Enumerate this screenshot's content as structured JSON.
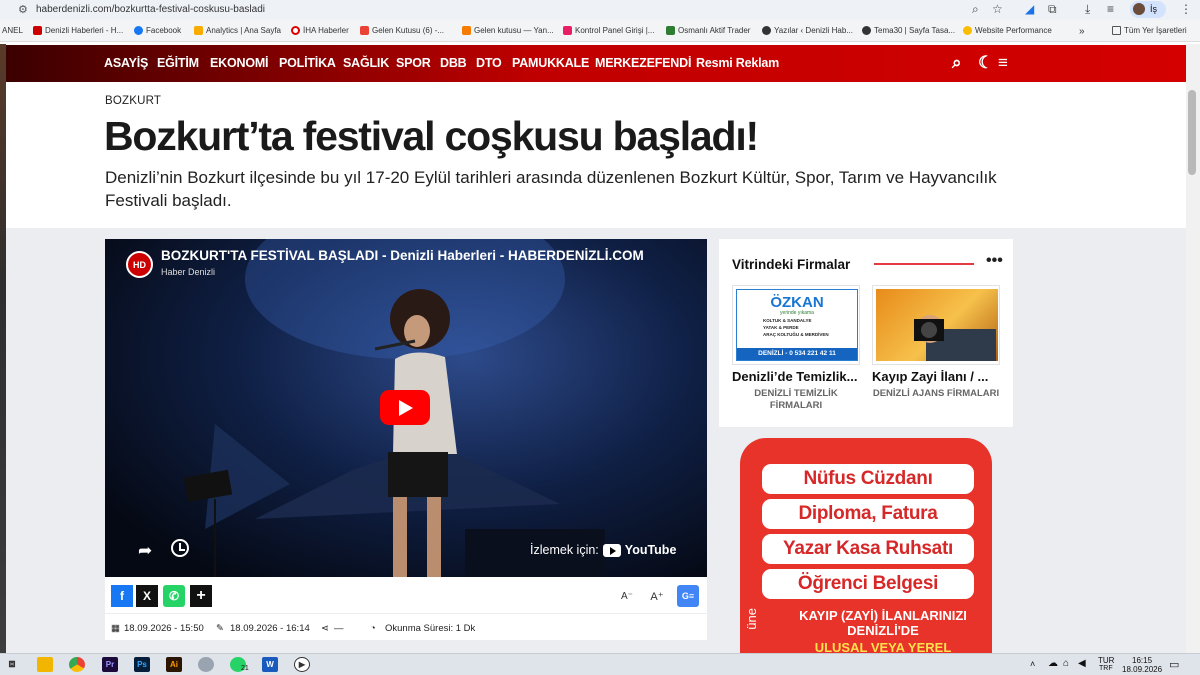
{
  "browser": {
    "url": "haberdenizli.com/bozkurtta-festival-coskusu-basladi",
    "profile_label": "İş"
  },
  "bookmarks": [
    "ANEL",
    "Denizli Haberleri - H...",
    "Facebook",
    "Analytics | Ana Sayfa",
    "İHA Haberler",
    "Gelen Kutusu (6) -...",
    "Gelen kutusu — Yan...",
    "Kontrol Panel Girişi |...",
    "Osmanlı Aktif Trader",
    "Yazılar ‹ Denizli Hab...",
    "Tema30 | Sayfa Tasa...",
    "Website Performance",
    "»",
    "Tüm Yer İşaretleri"
  ],
  "nav": [
    "ASAYİŞ",
    "EĞİTİM",
    "EKONOMİ",
    "POLİTİKA",
    "SAĞLIK",
    "SPOR",
    "DBB",
    "DTO",
    "PAMUKKALE",
    "MERKEZEFENDİ",
    "Resmi Reklam"
  ],
  "article": {
    "category": "BOZKURT",
    "title": "Bozkurt’ta festival coşkusu başladı!",
    "description": "Denizli’nin Bozkurt ilçesinde bu yıl 17-20 Eylül tarihleri arasında düzenlenen Bozkurt Kültür, Spor, Tarım ve Hayvancılık Festivali başladı."
  },
  "video": {
    "logo": "HD",
    "title": "BOZKURT'TA FESTİVAL BAŞLADI - Denizli Haberleri - HABERDENİZLİ.COM",
    "channel": "Haber Denizli",
    "watch_on": "İzlemek için:",
    "platform": "YouTube"
  },
  "share": {
    "facebook": "f",
    "x": "X",
    "whatsapp": "✆",
    "more": "+",
    "font_small": "A⁻",
    "font_large": "A⁺"
  },
  "meta": {
    "published": "18.09.2026 - 15:50",
    "updated": "18.09.2026 - 16:14",
    "shares": "—",
    "reading_time": "Okunma Süresi: 1 Dk"
  },
  "vitrin": {
    "title": "Vitrindeki Firmalar",
    "cards": [
      {
        "title": "Denizli’de Temizlik...",
        "category": "DENİZLİ TEMİZLİK FİRMALARI",
        "image_text": "ÖZKAN",
        "image_sub": "yerinde yıkama",
        "image_list": [
          "KOLTUK & SANDALYE",
          "YATAK & PERDE",
          "ARAÇ KOLTUĞU & MERDİVEN"
        ],
        "image_phone": "DENİZLİ - 0 534 221 42 11"
      },
      {
        "title": "Kayıp Zayi İlanı / ...",
        "category": "DENİZLİ AJANS FİRMALARI"
      }
    ]
  },
  "ad": {
    "items": [
      "Nüfus Cüzdanı",
      "Diploma, Fatura",
      "Yazar Kasa Ruhsatı",
      "Öğrenci Belgesi"
    ],
    "line1": "KAYIP (ZAYİ) İLANLARINIZI",
    "line2": "DENİZLİ'DE",
    "line3": "ULUSAL VEYA YEREL",
    "side": "üne"
  },
  "taskbar": {
    "lang": "TUR",
    "lang2": "TRF",
    "time": "16:15",
    "date": "18.09.2026",
    "notif": "21"
  },
  "colors": {
    "nav_start": "#3b0000",
    "nav_end": "#d40000",
    "accent": "#e63946",
    "ad_bg": "#e8332a"
  }
}
